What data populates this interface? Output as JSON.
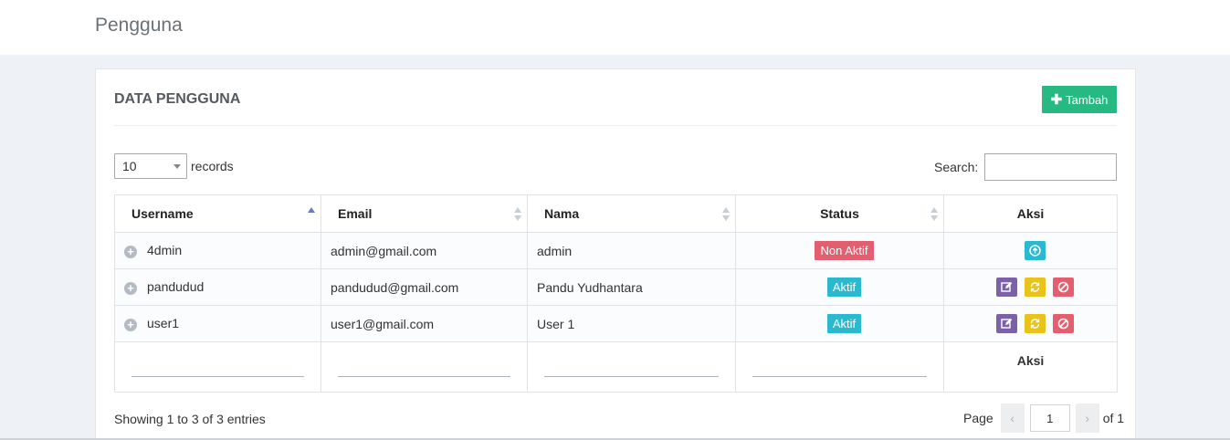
{
  "header": {
    "title": "Pengguna"
  },
  "card": {
    "title": "DATA PENGGUNA",
    "add_button": "Tambah"
  },
  "controls": {
    "length_value": "10",
    "length_label": "records",
    "search_label": "Search:",
    "search_value": ""
  },
  "table": {
    "columns": [
      "Username",
      "Email",
      "Nama",
      "Status",
      "Aksi"
    ],
    "rows": [
      {
        "username": "4dmin",
        "email": "admin@gmail.com",
        "nama": "admin",
        "status": "Non Aktif",
        "status_color": "#e35e6e",
        "actions": [
          "activate-icon"
        ]
      },
      {
        "username": "pandudud",
        "email": "pandudud@gmail.com",
        "nama": "Pandu Yudhantara",
        "status": "Aktif",
        "status_color": "#2bb9d0",
        "actions": [
          "edit-icon",
          "reset-icon",
          "block-icon"
        ]
      },
      {
        "username": "user1",
        "email": "user1@gmail.com",
        "nama": "User 1",
        "status": "Aktif",
        "status_color": "#2bb9d0",
        "actions": [
          "edit-icon",
          "reset-icon",
          "block-icon"
        ]
      }
    ],
    "footer_aksi": "Aksi",
    "sorted_column": "Username",
    "sort_direction": "ascending"
  },
  "footer": {
    "info": "Showing 1 to 3 of 3 entries",
    "page_label": "Page",
    "prev": "‹",
    "page_value": "1",
    "next": "›",
    "of_label": "of 1"
  },
  "colors": {
    "accent_green": "#26b981",
    "danger": "#e35e6e",
    "info": "#2bb9d0",
    "edit": "#7b62a8",
    "warning": "#e9c21a"
  }
}
